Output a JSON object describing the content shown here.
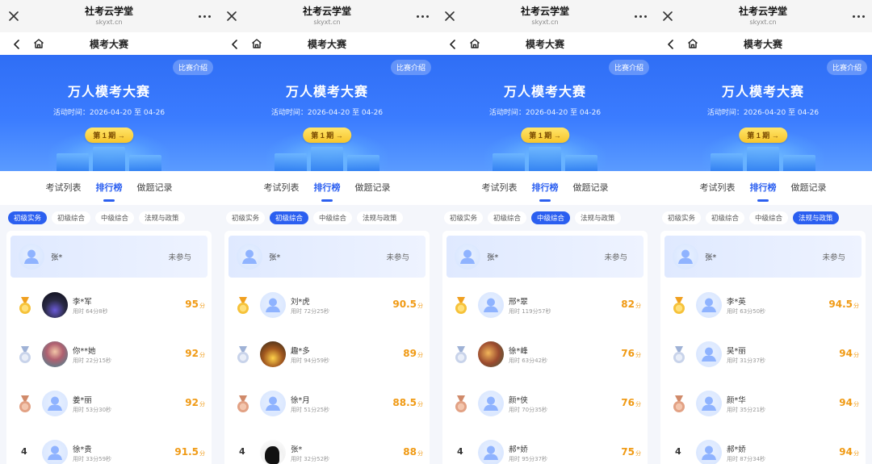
{
  "top": {
    "site": "社考云学堂",
    "domain": "skyxt.cn"
  },
  "nav": {
    "title": "模考大赛"
  },
  "banner": {
    "intro": "比赛介绍",
    "title": "万人模考大赛",
    "time": "活动时间：2026-04-20 至 04-26",
    "period": "第 1 期 →"
  },
  "tabs": [
    "考试列表",
    "排行榜",
    "做题记录"
  ],
  "categories": [
    "初级实务",
    "初级综合",
    "中级综合",
    "法规与政策"
  ],
  "icons": {
    "close": "close-icon",
    "more": "more-icon",
    "back": "back-icon",
    "home": "home-icon",
    "medal_gold": "gold-medal-icon",
    "medal_silver": "silver-medal-icon",
    "medal_bronze": "bronze-medal-icon",
    "avatar": "default-avatar-icon"
  },
  "colors": {
    "accent": "#2b5ff0",
    "score": "#f09a14",
    "banner": "#3b7cff",
    "period_button": "#f7c52b"
  },
  "panels": [
    {
      "active_category": 0,
      "me": {
        "name": "张*",
        "status": "未参与"
      },
      "rows": [
        {
          "rank": "1",
          "name": "李*军",
          "time": "用时 64分8秒",
          "score": "95",
          "unit": "分",
          "avatar": "photo-dark"
        },
        {
          "rank": "2",
          "name": "你**她",
          "time": "用时 22分15秒",
          "score": "92",
          "unit": "分",
          "avatar": "photo-girl"
        },
        {
          "rank": "3",
          "name": "姜*丽",
          "time": "用时 53分30秒",
          "score": "92",
          "unit": "分",
          "avatar": "default"
        },
        {
          "rank": "4",
          "name": "徐*贵",
          "time": "用时 33分59秒",
          "score": "91.5",
          "unit": "分",
          "avatar": "default"
        }
      ]
    },
    {
      "active_category": 1,
      "me": {
        "name": "张*",
        "status": "未参与"
      },
      "rows": [
        {
          "rank": "1",
          "name": "刘*虎",
          "time": "用时 72分25秒",
          "score": "90.5",
          "unit": "分",
          "avatar": "default"
        },
        {
          "rank": "2",
          "name": "趣*多",
          "time": "用时 94分59秒",
          "score": "89",
          "unit": "分",
          "avatar": "photo-sunset"
        },
        {
          "rank": "3",
          "name": "徐*月",
          "time": "用时 51分25秒",
          "score": "88.5",
          "unit": "分",
          "avatar": "default"
        },
        {
          "rank": "4",
          "name": "张*",
          "time": "用时 32分52秒",
          "score": "88",
          "unit": "分",
          "avatar": "photo-silhouette"
        }
      ]
    },
    {
      "active_category": 2,
      "me": {
        "name": "张*",
        "status": "未参与"
      },
      "rows": [
        {
          "rank": "1",
          "name": "邢*翠",
          "time": "用时 119分57秒",
          "score": "82",
          "unit": "分",
          "avatar": "default"
        },
        {
          "rank": "2",
          "name": "徐*峰",
          "time": "用时 63分42秒",
          "score": "76",
          "unit": "分",
          "avatar": "photo-forest"
        },
        {
          "rank": "3",
          "name": "颜*侠",
          "time": "用时 70分35秒",
          "score": "76",
          "unit": "分",
          "avatar": "default"
        },
        {
          "rank": "4",
          "name": "郝*娇",
          "time": "用时 95分37秒",
          "score": "75",
          "unit": "分",
          "avatar": "default"
        }
      ]
    },
    {
      "active_category": 3,
      "me": {
        "name": "张*",
        "status": "未参与"
      },
      "rows": [
        {
          "rank": "1",
          "name": "李*英",
          "time": "用时 63分50秒",
          "score": "94.5",
          "unit": "分",
          "avatar": "default"
        },
        {
          "rank": "2",
          "name": "吴*丽",
          "time": "用时 31分37秒",
          "score": "94",
          "unit": "分",
          "avatar": "default"
        },
        {
          "rank": "3",
          "name": "颜*华",
          "time": "用时 35分21秒",
          "score": "94",
          "unit": "分",
          "avatar": "default"
        },
        {
          "rank": "4",
          "name": "郝*娇",
          "time": "用时 87分34秒",
          "score": "94",
          "unit": "分",
          "avatar": "default"
        }
      ]
    }
  ]
}
